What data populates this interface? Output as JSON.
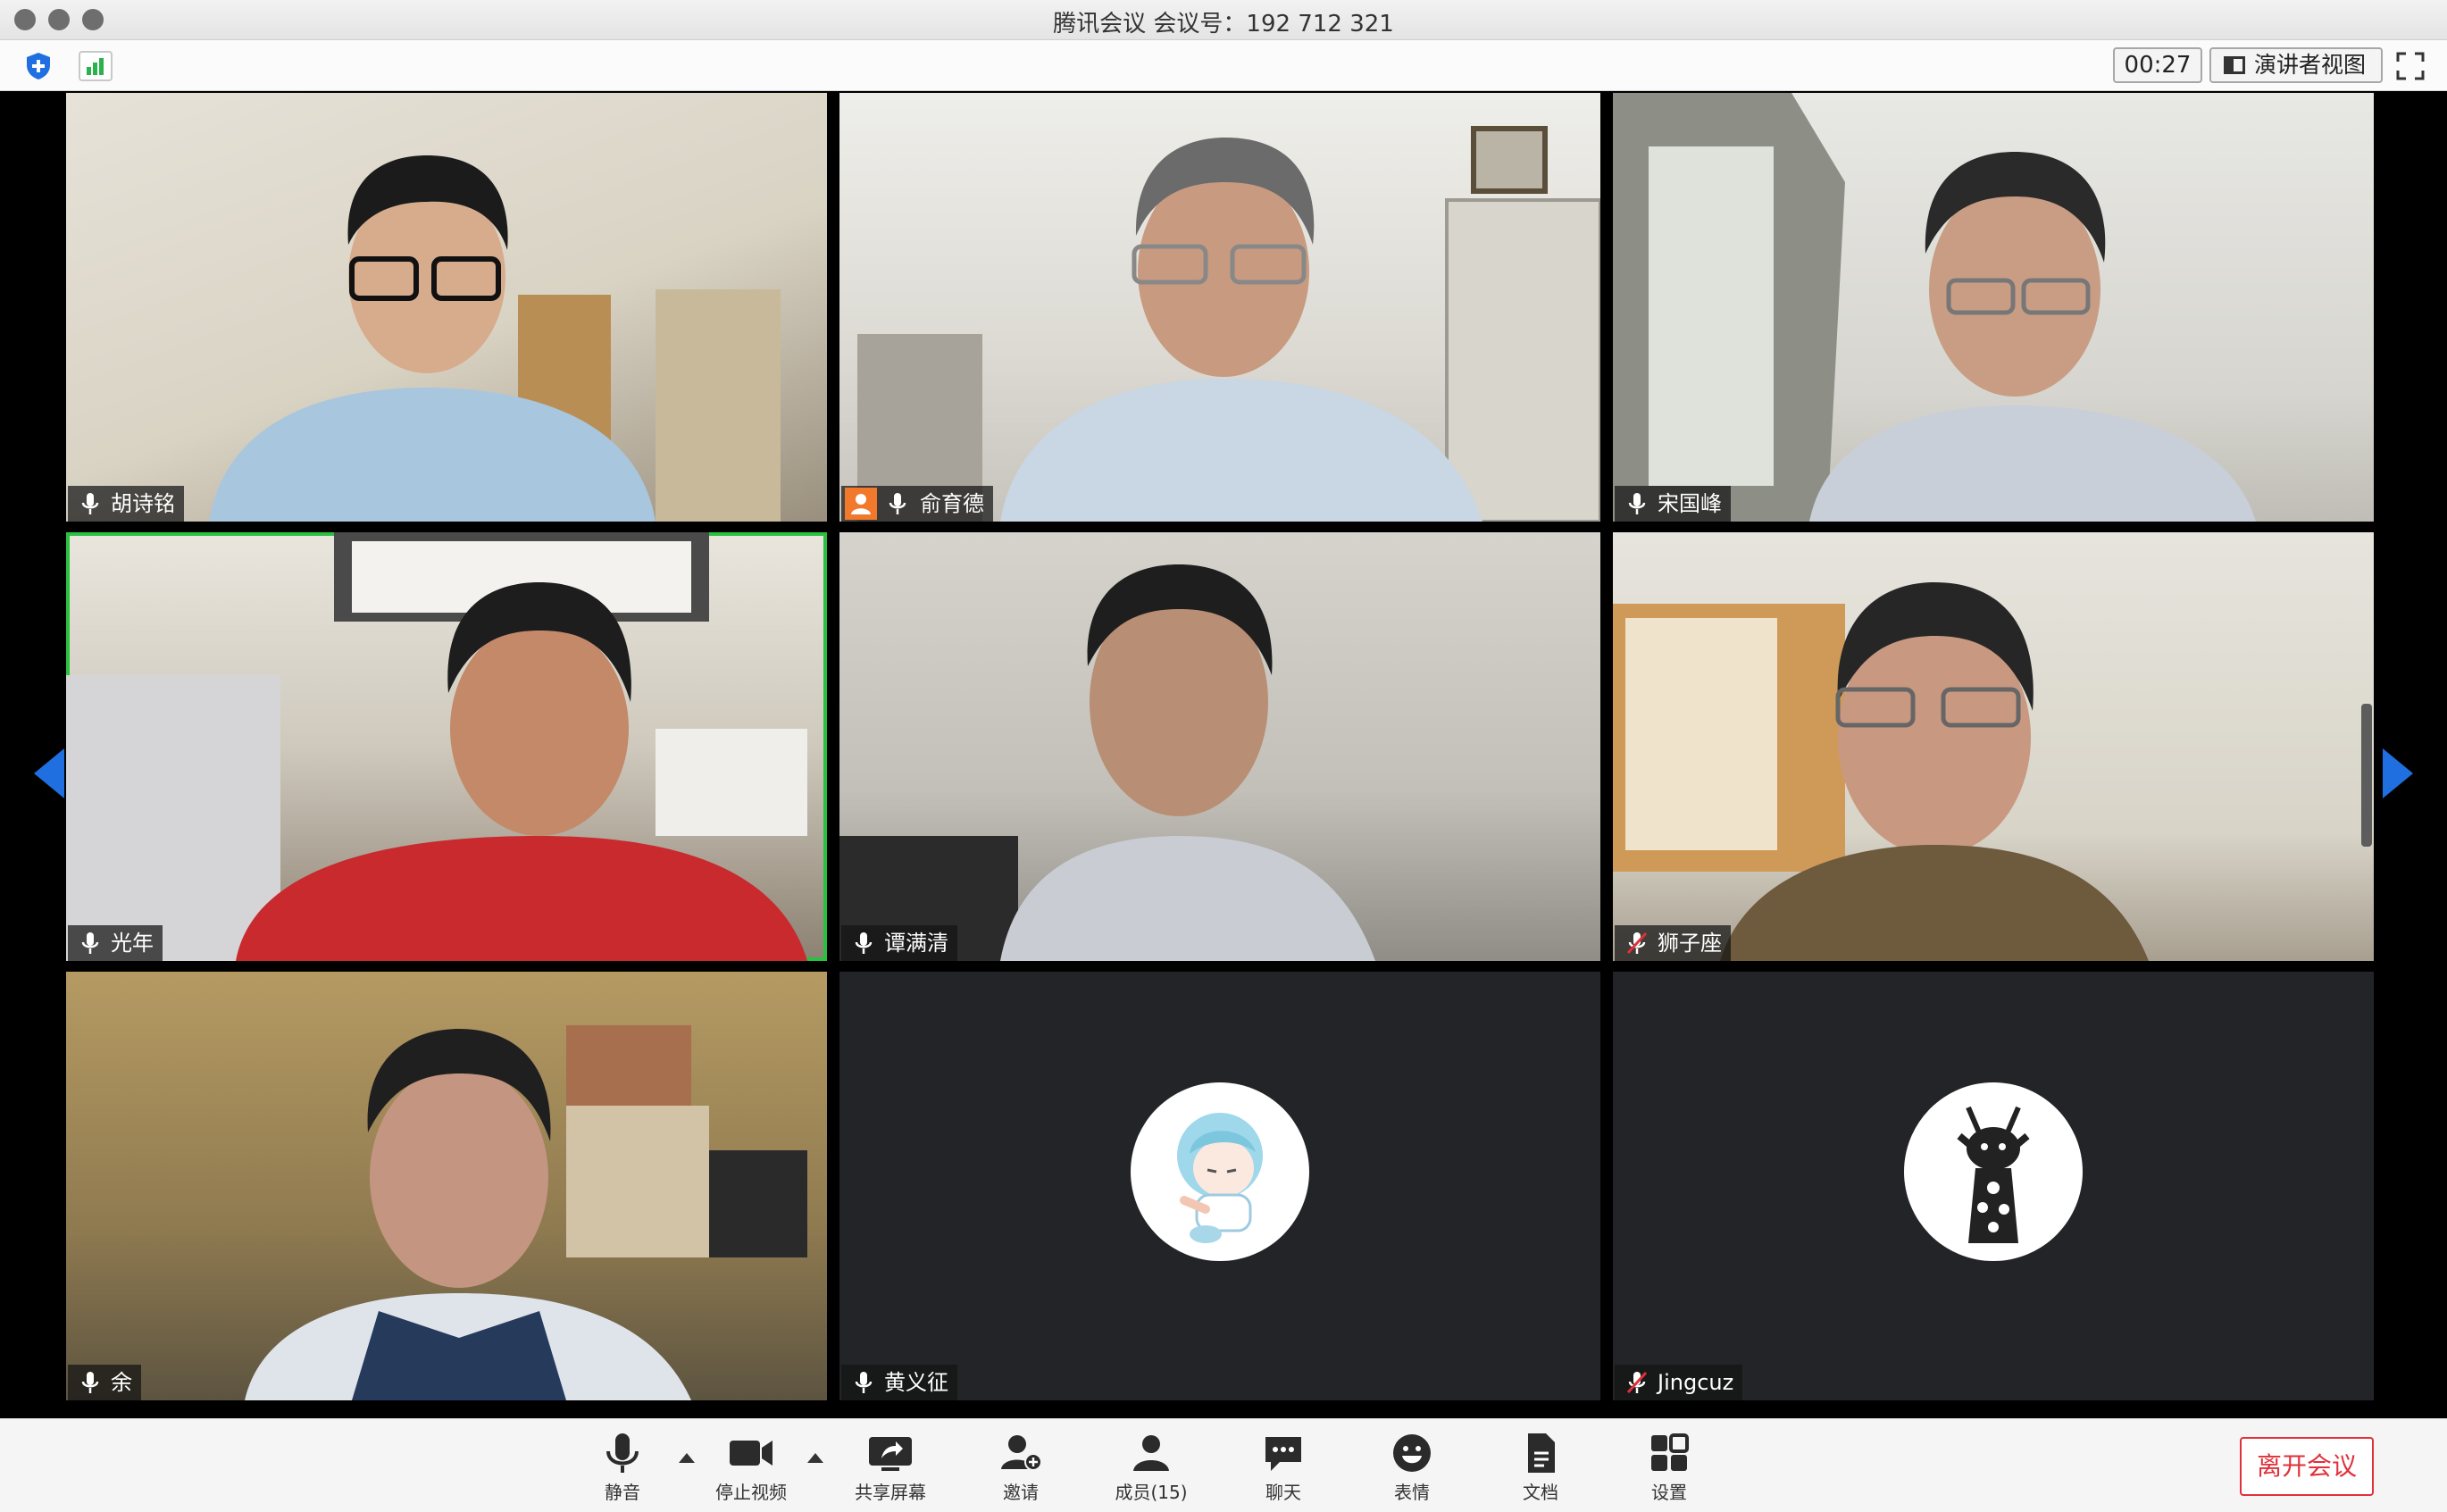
{
  "window": {
    "title": "腾讯会议 会议号：192 712 321"
  },
  "toolbar": {
    "timer": "00:27",
    "view_button": "演讲者视图"
  },
  "participants": [
    {
      "name": "胡诗铭"
    },
    {
      "name": "俞育德",
      "host": true
    },
    {
      "name": "宋国峰"
    },
    {
      "name": "光年",
      "speaking": true
    },
    {
      "name": "谭满清"
    },
    {
      "name": "狮子座",
      "muted": true
    },
    {
      "name": "余"
    },
    {
      "name": "黄义征",
      "video_off": true
    },
    {
      "name": "Jingcuz",
      "video_off": true,
      "muted": true
    }
  ],
  "bottom_bar": {
    "mute": "静音",
    "stop_video": "停止视频",
    "share_screen": "共享屏幕",
    "invite": "邀请",
    "members": "成员(15)",
    "chat": "聊天",
    "emoji": "表情",
    "docs": "文档",
    "settings": "设置",
    "leave": "离开会议"
  },
  "colors": {
    "accent": "#1f6fe0",
    "speaking_border": "#2bc140",
    "leave": "#e0303a",
    "host_badge": "#f2792b"
  }
}
